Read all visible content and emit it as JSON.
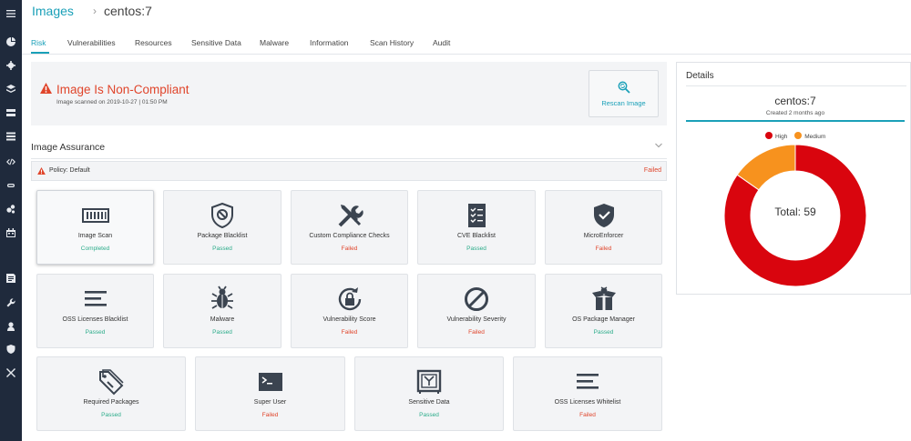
{
  "breadcrumb": {
    "root": "Images",
    "separator": "›",
    "current": "centos:7"
  },
  "tabs": [
    {
      "label": "Risk",
      "active": true
    },
    {
      "label": "Vulnerabilities"
    },
    {
      "label": "Resources"
    },
    {
      "label": "Sensitive Data"
    },
    {
      "label": "Malware"
    },
    {
      "label": "Information"
    },
    {
      "label": "Scan History"
    },
    {
      "label": "Audit"
    }
  ],
  "compliance": {
    "title": "Image Is Non-Compliant",
    "scanned": "Image scanned on 2019-10-27 | 01:50 PM",
    "rescan_label": "Rescan Image"
  },
  "assurance": {
    "title": "Image Assurance",
    "policy_label": "Policy: Default",
    "policy_status": "Failed",
    "cards": [
      {
        "label": "Image Scan",
        "status": "Completed",
        "icon": "barcode-icon"
      },
      {
        "label": "Package Blacklist",
        "status": "Passed",
        "icon": "blocked-shield-icon"
      },
      {
        "label": "Custom Compliance Checks",
        "status": "Failed",
        "icon": "tools-icon"
      },
      {
        "label": "CVE Blacklist",
        "status": "Passed",
        "icon": "checklist-icon"
      },
      {
        "label": "MicroEnforcer",
        "status": "Failed",
        "icon": "shield-check-icon"
      },
      {
        "label": "OSS Licenses Blacklist",
        "status": "Passed",
        "icon": "lines-icon"
      },
      {
        "label": "Malware",
        "status": "Passed",
        "icon": "bug-icon"
      },
      {
        "label": "Vulnerability Score",
        "status": "Failed",
        "icon": "lock-refresh-icon"
      },
      {
        "label": "Vulnerability Severity",
        "status": "Failed",
        "icon": "no-entry-icon"
      },
      {
        "label": "OS Package Manager",
        "status": "Passed",
        "icon": "open-box-icon"
      },
      {
        "label": "Required Packages",
        "status": "Passed",
        "icon": "tags-icon"
      },
      {
        "label": "Super User",
        "status": "Failed",
        "icon": "terminal-icon"
      },
      {
        "label": "Sensitive Data",
        "status": "Passed",
        "icon": "safe-icon"
      },
      {
        "label": "OSS Licenses Whitelist",
        "status": "Failed",
        "icon": "lines-icon"
      }
    ]
  },
  "details": {
    "title": "Details",
    "image_name": "centos:7",
    "created": "Created 2 months ago",
    "total_label": "Total: 59"
  },
  "colors": {
    "accent": "#1aa0b8",
    "high": "#d9050e",
    "medium": "#f7921e",
    "passed": "#2bac8a",
    "failed": "#e0452b"
  },
  "chart_data": {
    "type": "pie",
    "donut": true,
    "total": 59,
    "series": [
      {
        "name": "High",
        "value": 50,
        "color": "#d9050e"
      },
      {
        "name": "Medium",
        "value": 9,
        "color": "#f7921e"
      }
    ],
    "legend_position": "top"
  }
}
